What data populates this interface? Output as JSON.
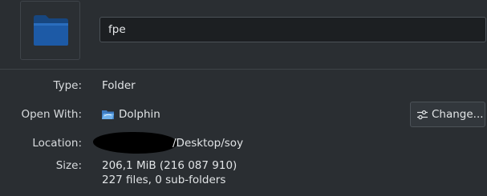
{
  "header": {
    "icon": "folder-icon",
    "name_value": "fpe"
  },
  "details": {
    "type_label": "Type:",
    "type_value": "Folder",
    "open_with_label": "Open With:",
    "open_with_app": "Dolphin",
    "open_with_icon": "dolphin-app-icon",
    "change_button_label": "Change...",
    "change_button_icon": "configure-icon",
    "location_label": "Location:",
    "location_value": "/Desktop/soy",
    "size_label": "Size:",
    "size_value": "206,1 MiB (216 087 910)",
    "contents_value": "227 files, 0 sub-folders"
  },
  "colors": {
    "background": "#2a2e32",
    "folder_blue": "#1d5aa6",
    "redaction": "#000000"
  }
}
